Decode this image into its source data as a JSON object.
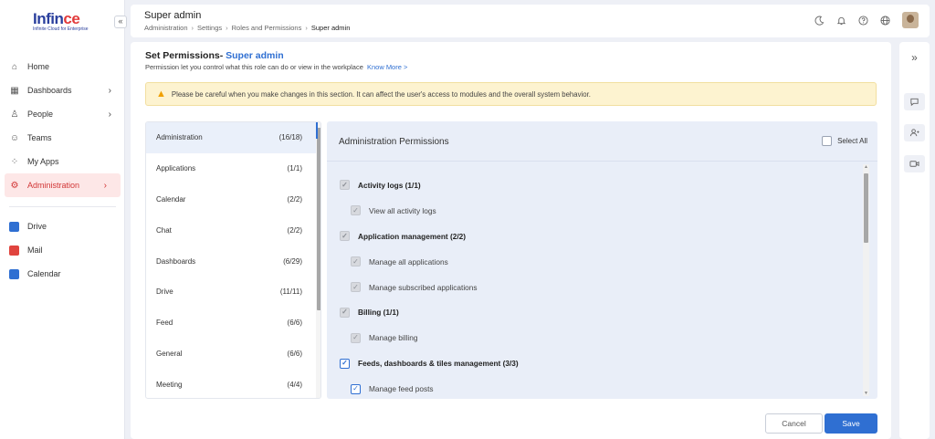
{
  "app": {
    "brand_main": "Infin",
    "brand_accent": "ce",
    "tagline": "Infinite Cloud for Enterprise",
    "collapse_label": "«"
  },
  "sidebar": {
    "items": [
      {
        "label": "Home",
        "icon": "home-icon",
        "glyph": "⌂",
        "chevron": false,
        "active": false
      },
      {
        "label": "Dashboards",
        "icon": "dashboard-icon",
        "glyph": "▦",
        "chevron": true,
        "active": false
      },
      {
        "label": "People",
        "icon": "people-icon",
        "glyph": "♙",
        "chevron": true,
        "active": false
      },
      {
        "label": "Teams",
        "icon": "teams-icon",
        "glyph": "☺",
        "chevron": false,
        "active": false
      },
      {
        "label": "My Apps",
        "icon": "apps-icon",
        "glyph": "⁘",
        "chevron": false,
        "active": false
      },
      {
        "label": "Administration",
        "icon": "admin-icon",
        "glyph": "⚙",
        "chevron": true,
        "active": true
      }
    ],
    "apps": [
      {
        "label": "Drive",
        "icon": "drive-icon",
        "color": "#2f6fd2"
      },
      {
        "label": "Mail",
        "icon": "mail-icon",
        "color": "#e0443e"
      },
      {
        "label": "Calendar",
        "icon": "calendar-icon",
        "color": "#2f6fd2"
      }
    ],
    "chevron_glyph": "›"
  },
  "header": {
    "title": "Super admin",
    "breadcrumb": [
      "Administration",
      "Settings",
      "Roles and Permissions",
      "Super admin"
    ],
    "breadcrumb_sep": "›"
  },
  "main": {
    "heading_prefix": "Set Permissions- ",
    "heading_role": "Super admin",
    "description": "Permission let you control what this role can do or view in the workplace",
    "know_more": "Know More >",
    "warning": "Please be careful when you make changes in this section. It can affect the user's access to modules and the overall system behavior."
  },
  "categories": [
    {
      "label": "Administration",
      "count": "(16/18)",
      "active": true
    },
    {
      "label": "Applications",
      "count": "(1/1)",
      "active": false
    },
    {
      "label": "Calendar",
      "count": "(2/2)",
      "active": false
    },
    {
      "label": "Chat",
      "count": "(2/2)",
      "active": false
    },
    {
      "label": "Dashboards",
      "count": "(6/29)",
      "active": false
    },
    {
      "label": "Drive",
      "count": "(11/11)",
      "active": false
    },
    {
      "label": "Feed",
      "count": "(6/6)",
      "active": false
    },
    {
      "label": "General",
      "count": "(6/6)",
      "active": false
    },
    {
      "label": "Meeting",
      "count": "(4/4)",
      "active": false
    }
  ],
  "permissions": {
    "title": "Administration Permissions",
    "select_all": "Select All",
    "rows": [
      {
        "label": "Activity logs (1/1)",
        "type": "group",
        "state": "disabled"
      },
      {
        "label": "View all activity logs",
        "type": "child",
        "state": "disabled"
      },
      {
        "label": "Application management (2/2)",
        "type": "group",
        "state": "disabled"
      },
      {
        "label": "Manage all applications",
        "type": "child",
        "state": "disabled"
      },
      {
        "label": "Manage subscribed applications",
        "type": "child",
        "state": "disabled"
      },
      {
        "label": "Billing (1/1)",
        "type": "group",
        "state": "disabled"
      },
      {
        "label": "Manage billing",
        "type": "child",
        "state": "disabled"
      },
      {
        "label": "Feeds, dashboards & tiles management (3/3)",
        "type": "group",
        "state": "checked"
      },
      {
        "label": "Manage feed posts",
        "type": "child",
        "state": "checked"
      }
    ]
  },
  "buttons": {
    "cancel": "Cancel",
    "save": "Save"
  },
  "colors": {
    "accent": "#2f6fd2",
    "brand_red": "#e23b3b",
    "brand_blue": "#2a3f9d",
    "warning_bg": "#fdf3d0"
  }
}
